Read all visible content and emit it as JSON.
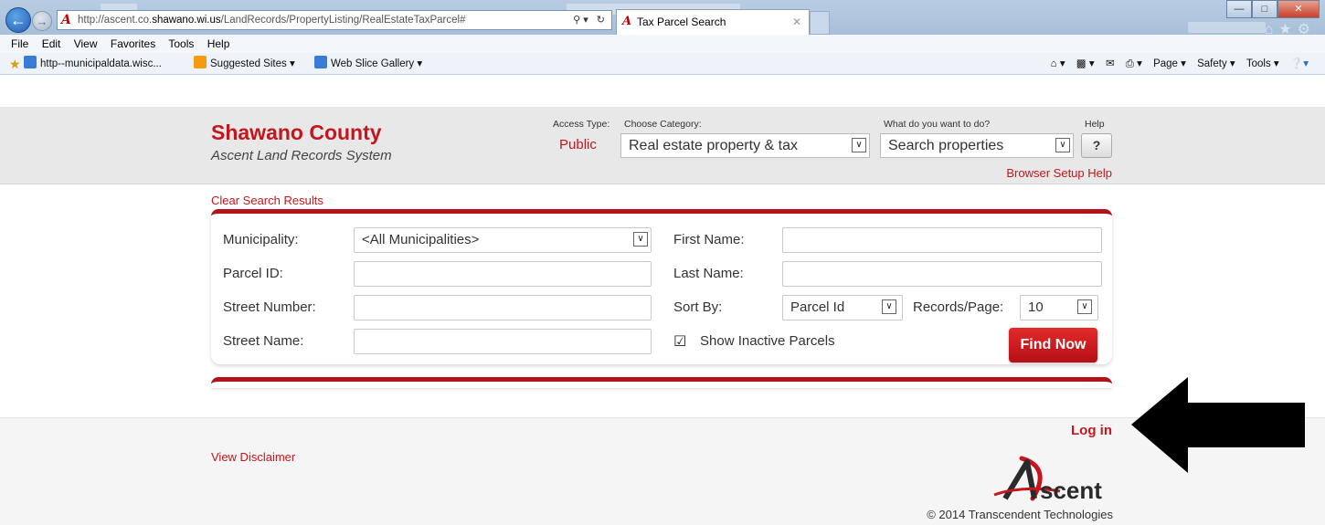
{
  "browser": {
    "url_prefix": "http://ascent.co.",
    "url_host": "shawano.wi.us",
    "url_path": "/LandRecords/PropertyListing/RealEstateTaxParcel#",
    "tab_title": "Tax Parcel Search",
    "menu": [
      "File",
      "Edit",
      "View",
      "Favorites",
      "Tools",
      "Help"
    ],
    "favorites": [
      {
        "label": "http--municipaldata.wisc...",
        "icon": "ie-page-icon"
      },
      {
        "label": "Suggested Sites ▾",
        "icon": "suggested-sites-icon"
      },
      {
        "label": "Web Slice Gallery ▾",
        "icon": "ie-page-icon"
      }
    ],
    "commands": [
      "Page ▾",
      "Safety ▾",
      "Tools ▾"
    ]
  },
  "header": {
    "title": "Shawano County",
    "subtitle": "Ascent Land Records System",
    "access_type_label": "Access Type:",
    "access_type_value": "Public",
    "category_label": "Choose Category:",
    "category_value": "Real estate property & tax",
    "action_label": "What do you want to do?",
    "action_value": "Search properties",
    "help_label": "Help",
    "help_button": "?",
    "browser_setup_help": "Browser Setup Help"
  },
  "search": {
    "clear_results": "Clear Search Results",
    "municipality_label": "Municipality:",
    "municipality_value": "<All Municipalities>",
    "parcel_id_label": "Parcel ID:",
    "parcel_id_value": "",
    "street_number_label": "Street Number:",
    "street_number_value": "",
    "street_name_label": "Street Name:",
    "street_name_value": "",
    "first_name_label": "First Name:",
    "first_name_value": "",
    "last_name_label": "Last Name:",
    "last_name_value": "",
    "sort_by_label": "Sort By:",
    "sort_by_value": "Parcel Id",
    "records_per_page_label": "Records/Page:",
    "records_per_page_value": "10",
    "show_inactive_label": "Show Inactive Parcels",
    "show_inactive_checked": true,
    "find_now": "Find Now"
  },
  "footer": {
    "login": "Log in",
    "disclaimer": "View Disclaimer",
    "logo_text": "scent",
    "copyright": "© 2014 Transcendent Technologies"
  },
  "colors": {
    "brand_red": "#c4161c",
    "panel_red": "#b3121b",
    "header_gray": "#e8e8e8",
    "arrow": "#000000"
  }
}
